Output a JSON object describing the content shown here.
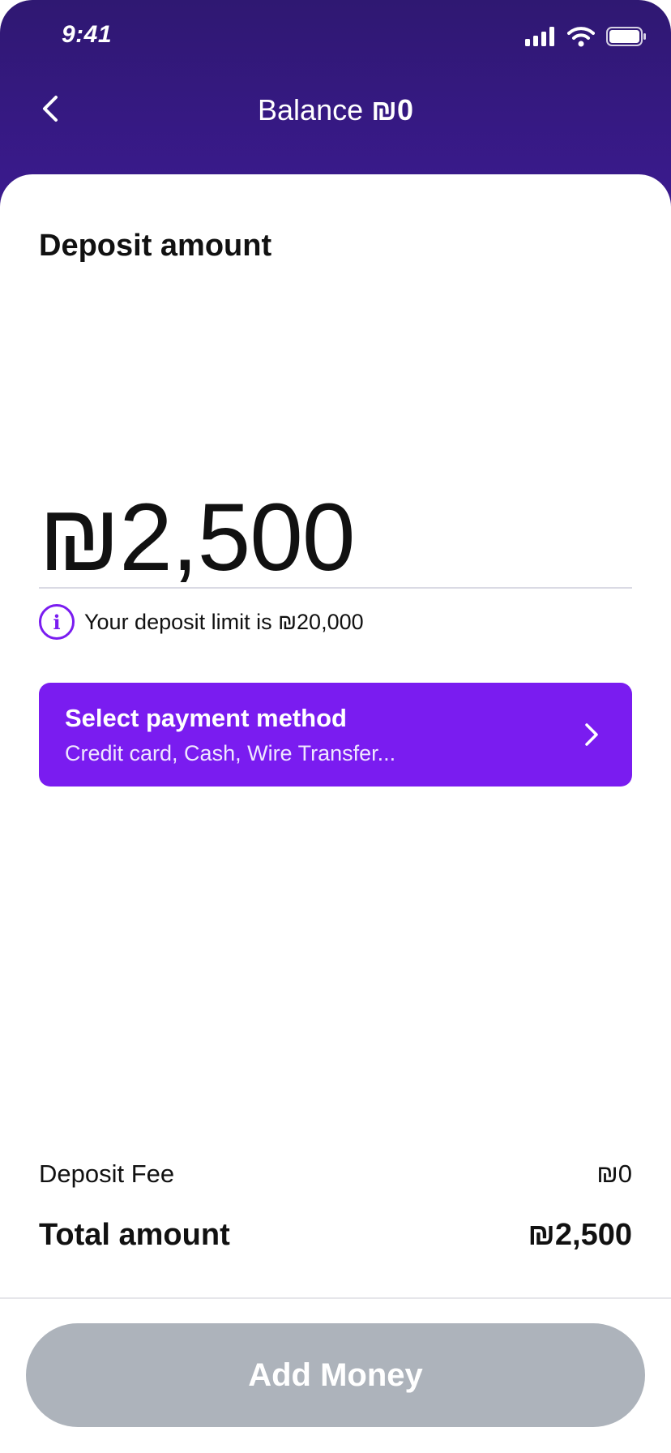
{
  "status_bar": {
    "time": "9:41"
  },
  "header": {
    "title_prefix": "Balance",
    "balance": "₪0"
  },
  "deposit": {
    "section_title": "Deposit amount",
    "amount": "₪2,500",
    "limit_text": "Your deposit limit is ₪20,000"
  },
  "payment": {
    "title": "Select payment method",
    "subtitle": "Credit card, Cash, Wire Transfer..."
  },
  "summary": {
    "fee_label": "Deposit Fee",
    "fee_value": "₪0",
    "total_label": "Total amount",
    "total_value": "₪2,500"
  },
  "footer": {
    "button_label": "Add Money"
  },
  "icons": {
    "back": "chevron-left-icon",
    "info": "info-icon",
    "next": "chevron-right-icon",
    "signal": "cellular-signal-icon",
    "wifi": "wifi-icon",
    "battery": "battery-icon"
  },
  "colors": {
    "header": "#35198a",
    "accent": "#7a1cf0",
    "button_disabled": "#adb3bb"
  }
}
